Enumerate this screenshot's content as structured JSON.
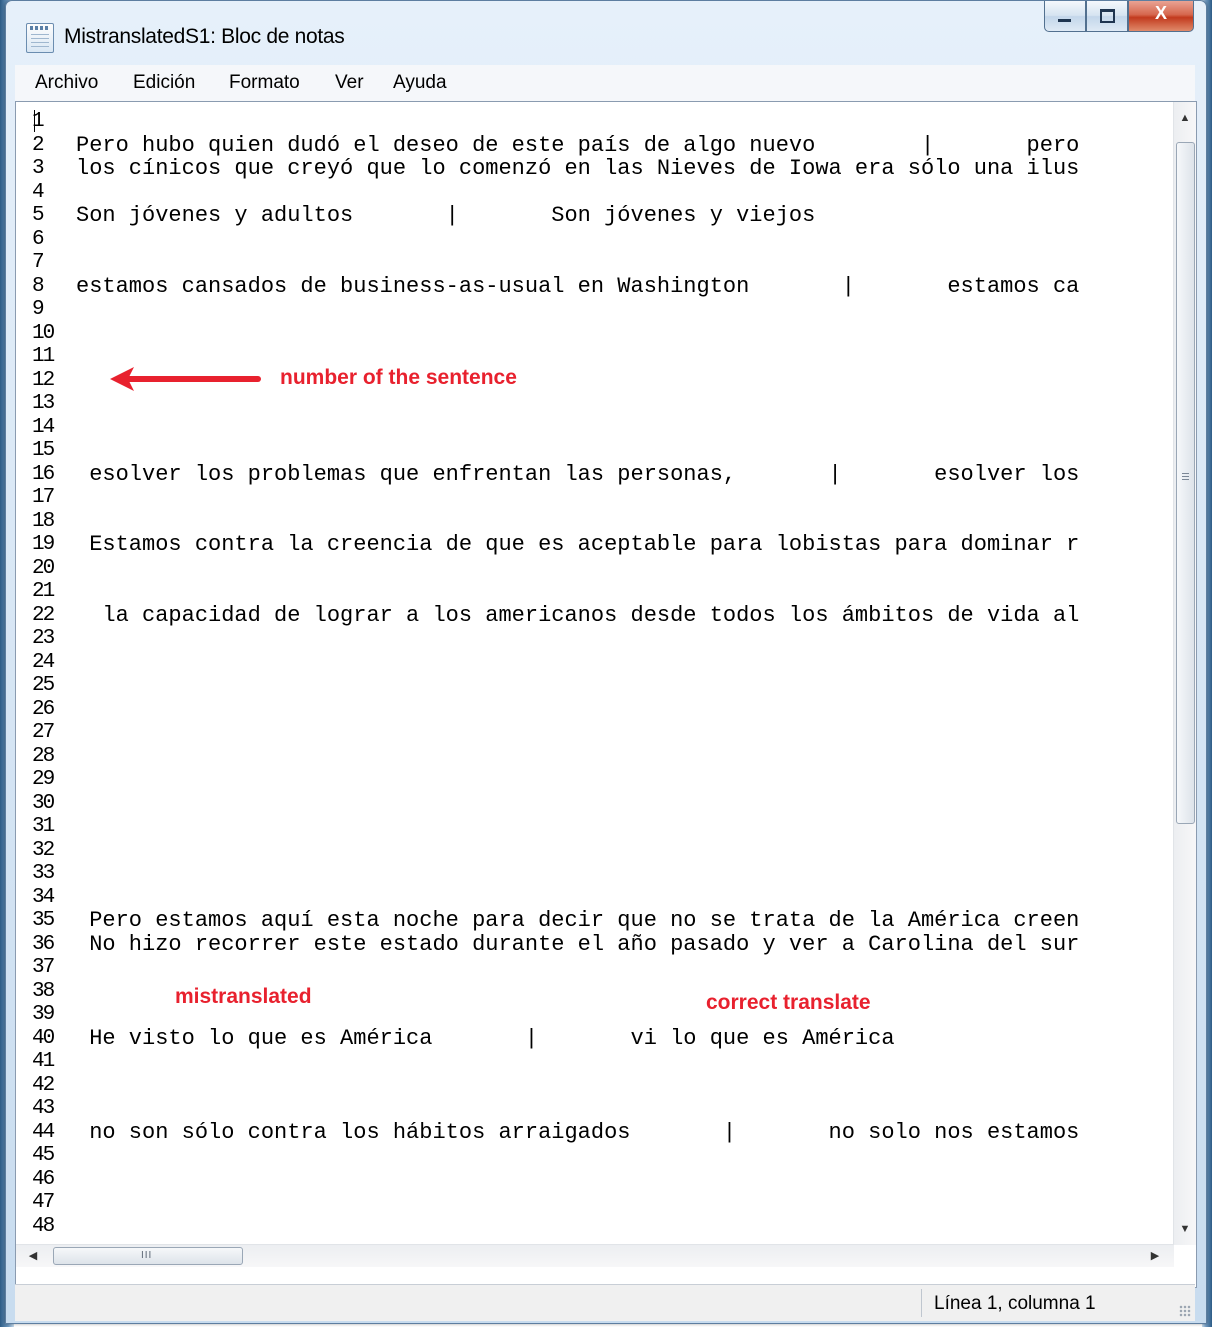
{
  "window": {
    "title": "MistranslatedS1: Bloc de notas",
    "minimize_glyph": "",
    "maximize_glyph": "",
    "close_glyph": "X"
  },
  "menu": {
    "items": [
      "Archivo",
      "Edición",
      "Formato",
      "Ver",
      "Ayuda"
    ]
  },
  "editor": {
    "lines": [
      {
        "n": "1",
        "text": ""
      },
      {
        "n": "2",
        "text": "Pero hubo quien dudó el deseo de este país de algo nuevo        |       pero"
      },
      {
        "n": "3",
        "text": "los cínicos que creyó que lo comenzó en las Nieves de Iowa era sólo una ilus"
      },
      {
        "n": "4",
        "text": ""
      },
      {
        "n": "5",
        "text": "Son jóvenes y adultos       |       Son jóvenes y viejos"
      },
      {
        "n": "6",
        "text": ""
      },
      {
        "n": "7",
        "text": ""
      },
      {
        "n": "8",
        "text": "estamos cansados de business-as-usual en Washington       |       estamos ca"
      },
      {
        "n": "9",
        "text": ""
      },
      {
        "n": "10",
        "text": ""
      },
      {
        "n": "11",
        "text": ""
      },
      {
        "n": "12",
        "text": ""
      },
      {
        "n": "13",
        "text": ""
      },
      {
        "n": "14",
        "text": ""
      },
      {
        "n": "15",
        "text": ""
      },
      {
        "n": "16",
        "text": " esolver los problemas que enfrentan las personas,       |       esolver los"
      },
      {
        "n": "17",
        "text": ""
      },
      {
        "n": "18",
        "text": ""
      },
      {
        "n": "19",
        "text": " Estamos contra la creencia de que es aceptable para lobistas para dominar r"
      },
      {
        "n": "20",
        "text": ""
      },
      {
        "n": "21",
        "text": ""
      },
      {
        "n": "22",
        "text": "  la capacidad de lograr a los americanos desde todos los ámbitos de vida al"
      },
      {
        "n": "23",
        "text": ""
      },
      {
        "n": "24",
        "text": ""
      },
      {
        "n": "25",
        "text": ""
      },
      {
        "n": "26",
        "text": ""
      },
      {
        "n": "27",
        "text": ""
      },
      {
        "n": "28",
        "text": ""
      },
      {
        "n": "29",
        "text": ""
      },
      {
        "n": "30",
        "text": ""
      },
      {
        "n": "31",
        "text": ""
      },
      {
        "n": "32",
        "text": ""
      },
      {
        "n": "33",
        "text": ""
      },
      {
        "n": "34",
        "text": ""
      },
      {
        "n": "35",
        "text": " Pero estamos aquí esta noche para decir que no se trata de la América creen"
      },
      {
        "n": "36",
        "text": " No hizo recorrer este estado durante el año pasado y ver a Carolina del sur"
      },
      {
        "n": "37",
        "text": ""
      },
      {
        "n": "38",
        "text": ""
      },
      {
        "n": "39",
        "text": ""
      },
      {
        "n": "40",
        "text": " He visto lo que es América       |       vi lo que es América"
      },
      {
        "n": "41",
        "text": ""
      },
      {
        "n": "42",
        "text": ""
      },
      {
        "n": "43",
        "text": ""
      },
      {
        "n": "44",
        "text": " no son sólo contra los hábitos arraigados       |       no solo nos estamos"
      },
      {
        "n": "45",
        "text": ""
      },
      {
        "n": "46",
        "text": ""
      },
      {
        "n": "47",
        "text": ""
      },
      {
        "n": "48",
        "text": ""
      }
    ]
  },
  "annotations": {
    "sentence_number": "number of the sentence",
    "mistranslated": "mistranslated",
    "correct": "correct translate",
    "color": "#e8212e"
  },
  "scrollbars": {
    "up_glyph": "▲",
    "down_glyph": "▼",
    "left_glyph": "◀",
    "right_glyph": "▶",
    "h_grip": "III"
  },
  "status": {
    "position": "Línea 1, columna 1"
  }
}
